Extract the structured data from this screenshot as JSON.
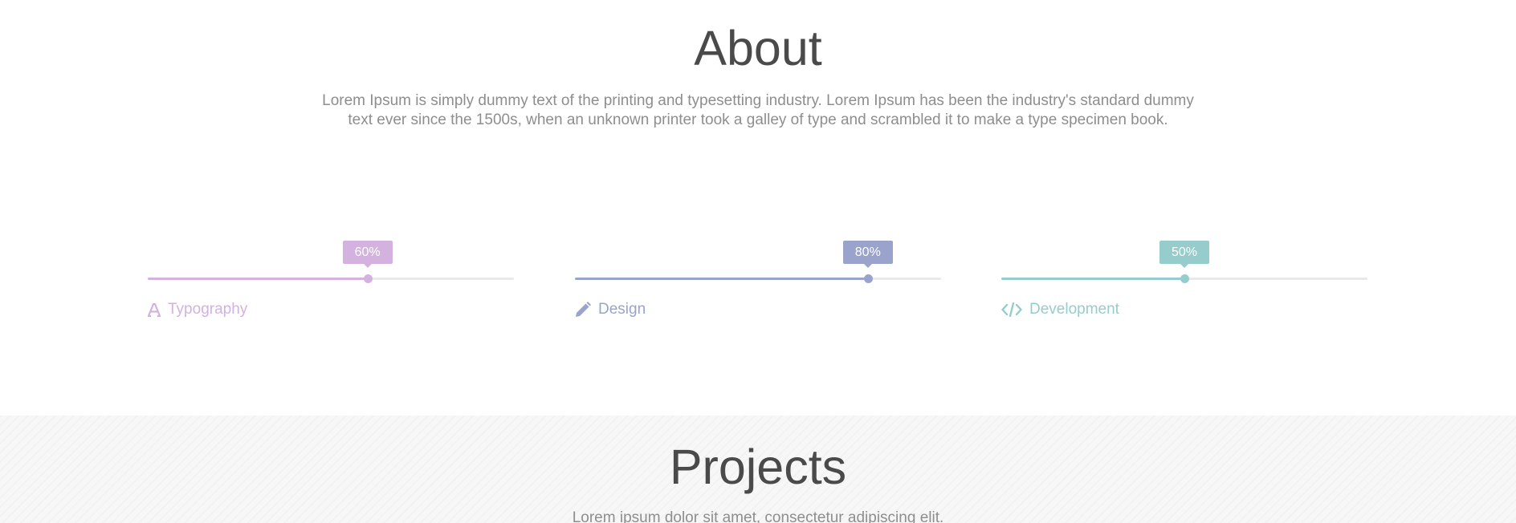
{
  "about": {
    "title": "About",
    "text": "Lorem Ipsum is simply dummy text of the printing and typesetting industry. Lorem Ipsum has been the industry's standard dummy text ever since the 1500s, when an unknown printer took a galley of type and scrambled it to make a type specimen book."
  },
  "skills": [
    {
      "label": "Typography",
      "percent_label": "60%",
      "fraction": 0.6,
      "icon": "font-icon",
      "color": "#d3b2e0"
    },
    {
      "label": "Design",
      "percent_label": "80%",
      "fraction": 0.8,
      "icon": "pencil-icon",
      "color": "#9aa3cc"
    },
    {
      "label": "Development",
      "percent_label": "50%",
      "fraction": 0.5,
      "icon": "code-icon",
      "color": "#96cdcc"
    }
  ],
  "projects": {
    "title": "Projects",
    "text": "Lorem ipsum dolor sit amet, consectetur adipiscing elit."
  }
}
